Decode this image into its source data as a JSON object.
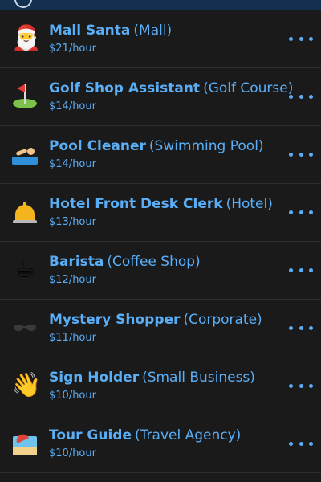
{
  "jobs": [
    {
      "icon": "santa-icon",
      "glyph": "🎅",
      "name": "Mall Santa",
      "place": "(Mall)",
      "pay": "$21/hour"
    },
    {
      "icon": "golf-flag-icon",
      "glyph": "",
      "name": "Golf Shop Assistant",
      "place": "(Golf Course)",
      "pay": "$14/hour"
    },
    {
      "icon": "swimmer-icon",
      "glyph": "",
      "name": "Pool Cleaner",
      "place": "(Swimming Pool)",
      "pay": "$14/hour"
    },
    {
      "icon": "bellhop-bell-icon",
      "glyph": "",
      "name": "Hotel Front Desk Clerk",
      "place": "(Hotel)",
      "pay": "$13/hour"
    },
    {
      "icon": "coffee-cup-icon",
      "glyph": "☕",
      "name": "Barista",
      "place": "(Coffee Shop)",
      "pay": "$12/hour"
    },
    {
      "icon": "sunglasses-icon",
      "glyph": "",
      "name": "Mystery Shopper",
      "place": "(Corporate)",
      "pay": "$11/hour"
    },
    {
      "icon": "waving-hand-icon",
      "glyph": "👋",
      "name": "Sign Holder",
      "place": "(Small Business)",
      "pay": "$10/hour"
    },
    {
      "icon": "beach-umbrella-icon",
      "glyph": "",
      "name": "Tour Guide",
      "place": "(Travel Agency)",
      "pay": "$10/hour"
    }
  ],
  "more_icon": "ellipsis-icon",
  "colors": {
    "background": "#1a1a1b",
    "accent": "#5aaef6",
    "header": "#13304f",
    "divider": "#2c2c2e"
  }
}
